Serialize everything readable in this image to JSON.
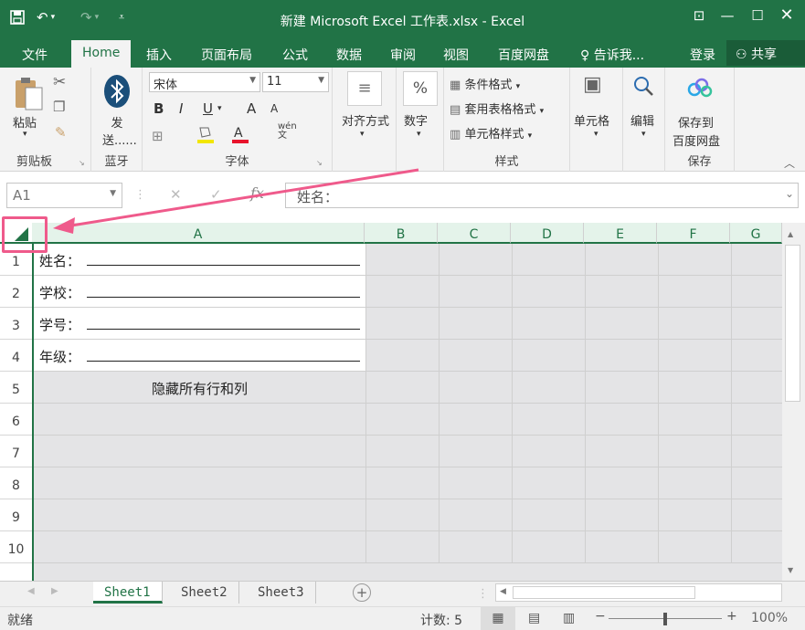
{
  "window": {
    "title": "新建 Microsoft Excel 工作表.xlsx - Excel"
  },
  "ribbon_tabs": {
    "file": "文件",
    "home": "Home",
    "insert": "插入",
    "page_layout": "页面布局",
    "formulas": "公式",
    "data": "数据",
    "review": "审阅",
    "view": "视图",
    "baidu": "百度网盘",
    "tell_me": "告诉我...",
    "login": "登录",
    "share": "共享"
  },
  "clipboard": {
    "paste": "粘贴",
    "label": "剪贴板"
  },
  "bluetooth": {
    "send": "发送......",
    "label": "蓝牙"
  },
  "font": {
    "name": "宋体",
    "size": "11",
    "label": "字体",
    "bold": "B",
    "italic": "I",
    "underline": "U",
    "grow": "A",
    "shrink": "A"
  },
  "alignment": {
    "label": "对齐方式"
  },
  "number": {
    "label": "数字",
    "symbol": "%"
  },
  "styles": {
    "conditional": "条件格式",
    "table": "套用表格格式",
    "cell": "单元格样式",
    "label": "样式"
  },
  "cells": {
    "label": "单元格"
  },
  "editing": {
    "label": "编辑"
  },
  "save": {
    "line1": "保存到",
    "line2": "百度网盘",
    "label": "保存"
  },
  "formula_bar": {
    "name_box": "A1",
    "fx": "fx",
    "content": "姓名："
  },
  "columns": [
    "A",
    "B",
    "C",
    "D",
    "E",
    "F",
    "G"
  ],
  "rows": [
    "1",
    "2",
    "3",
    "4",
    "5",
    "6",
    "7",
    "8",
    "9",
    "10"
  ],
  "cells_data": {
    "A1": "姓名：",
    "A2": "学校：",
    "A3": "学号：",
    "A4": "年级：",
    "A5": "隐藏所有行和列"
  },
  "sheet_tabs": [
    "Sheet1",
    "Sheet2",
    "Sheet3"
  ],
  "statusbar": {
    "ready": "就绪",
    "count": "计数: 5",
    "zoom": "100%"
  },
  "colors": {
    "accent": "#217346",
    "highlight": "#ef5a8b"
  }
}
